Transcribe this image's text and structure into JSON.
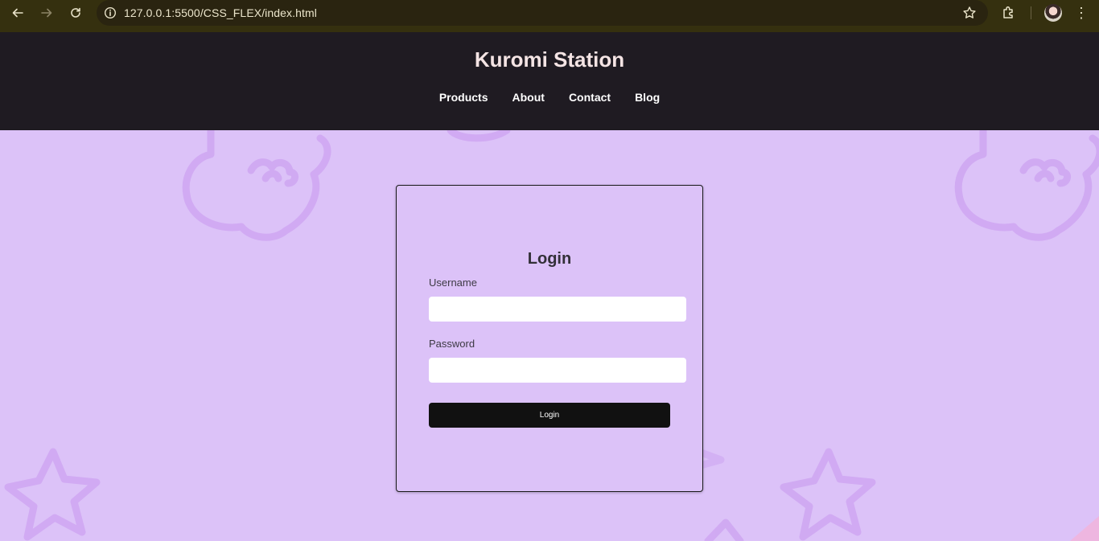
{
  "browser": {
    "url": "127.0.0.1:5500/CSS_FLEX/index.html",
    "icons": [
      "back-arrow-icon",
      "forward-arrow-icon",
      "reload-icon",
      "site-info-icon",
      "star-icon",
      "extensions-icon",
      "profile-avatar",
      "menu-dots-icon"
    ]
  },
  "header": {
    "brand": "Kuromi Station",
    "nav": [
      "Products",
      "About",
      "Contact",
      "Blog"
    ]
  },
  "login": {
    "title": "Login",
    "username_label": "Username",
    "username_value": "",
    "password_label": "Password",
    "password_value": "",
    "button_label": "Login"
  },
  "colors": {
    "chrome_bg": "#35300f",
    "header_bg": "#1f1b22",
    "page_bg": "#dcc2f8",
    "deco_stroke": "#cfa6f2",
    "button_bg": "#111111"
  }
}
